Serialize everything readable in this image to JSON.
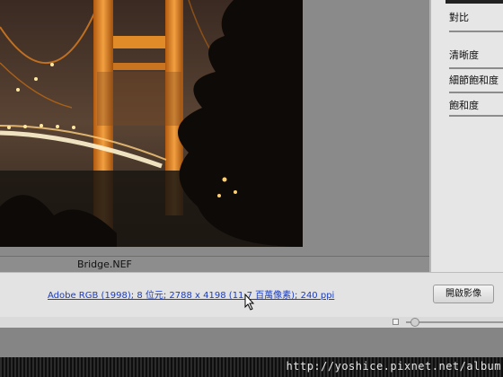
{
  "image": {
    "filename": "Bridge.NEF"
  },
  "adjustments": {
    "items": [
      {
        "label": "對比"
      },
      {
        "label": "清晰度"
      },
      {
        "label": "細節飽和度"
      },
      {
        "label": "飽和度"
      }
    ]
  },
  "info": {
    "workflow_link": "Adobe RGB (1998); 8 位元; 2788 x 4198 (11.7 百萬像素); 240 ppi"
  },
  "buttons": {
    "open_image": "開啟影像"
  },
  "zoom": {
    "level": 0.09
  },
  "watermark": {
    "text": "http://yoshice.pixnet.net/album"
  },
  "colors": {
    "link": "#1a3cc4",
    "panel_bg": "#e6e6e6",
    "bridge_orange": "#e8891c"
  }
}
